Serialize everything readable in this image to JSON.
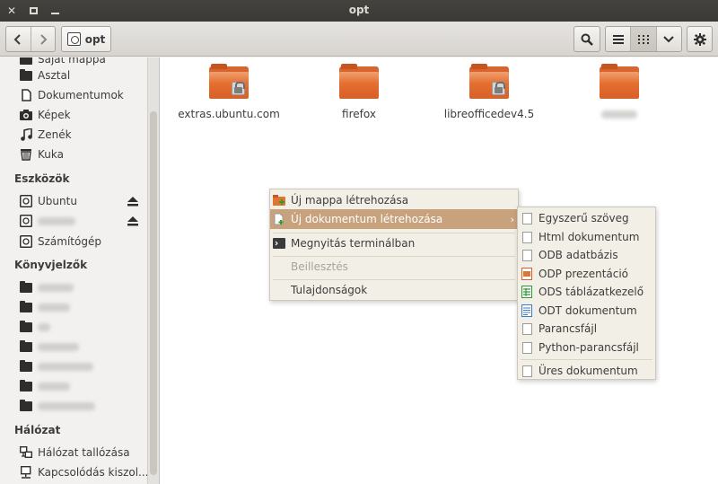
{
  "window": {
    "title": "opt"
  },
  "toolbar": {
    "path_label": "opt"
  },
  "sidebar": {
    "personal": [
      {
        "label": "Saját mappa",
        "icon": "home-folder-icon"
      },
      {
        "label": "Asztal",
        "icon": "folder-icon"
      },
      {
        "label": "Dokumentumok",
        "icon": "document-icon"
      },
      {
        "label": "Képek",
        "icon": "camera-icon"
      },
      {
        "label": "Zenék",
        "icon": "music-icon"
      },
      {
        "label": "Kuka",
        "icon": "trash-icon"
      }
    ],
    "devices_heading": "Eszközök",
    "devices": [
      {
        "label": "Ubuntu",
        "icon": "drive-icon"
      },
      {
        "label": "",
        "icon": "drive-icon"
      },
      {
        "label": "Számítógép",
        "icon": "computer-icon"
      }
    ],
    "bookmarks_heading": "Könyvjelzők",
    "network_heading": "Hálózat",
    "network": [
      {
        "label": "Hálózat tallózása",
        "icon": "network-icon"
      },
      {
        "label": "Kapcsolódás kiszol...",
        "icon": "server-icon"
      }
    ]
  },
  "files": [
    {
      "name": "extras.ubuntu.com",
      "locked": true
    },
    {
      "name": "firefox",
      "locked": false
    },
    {
      "name": "libreofficedev4.5",
      "locked": true
    },
    {
      "name": "",
      "locked": false
    }
  ],
  "context_menu": {
    "items": [
      {
        "label": "Új mappa létrehozása"
      },
      {
        "label": "Új dokumentum létrehozása"
      },
      {
        "label": "Megnyitás terminálban"
      },
      {
        "label": "Beillesztés"
      },
      {
        "label": "Tulajdonságok"
      }
    ]
  },
  "submenu": {
    "items": [
      {
        "label": "Egyszerű szöveg"
      },
      {
        "label": "Html dokumentum"
      },
      {
        "label": "ODB adatbázis"
      },
      {
        "label": "ODP prezentáció"
      },
      {
        "label": "ODS táblázatkezelő"
      },
      {
        "label": "ODT dokumentum"
      },
      {
        "label": "Parancsfájl"
      },
      {
        "label": "Python-parancsfájl"
      },
      {
        "label": "Üres dokumentum"
      }
    ]
  },
  "colors": {
    "accent": "#c8a27d",
    "folder": "#e46d2e",
    "titlebar": "#3c3b37"
  }
}
